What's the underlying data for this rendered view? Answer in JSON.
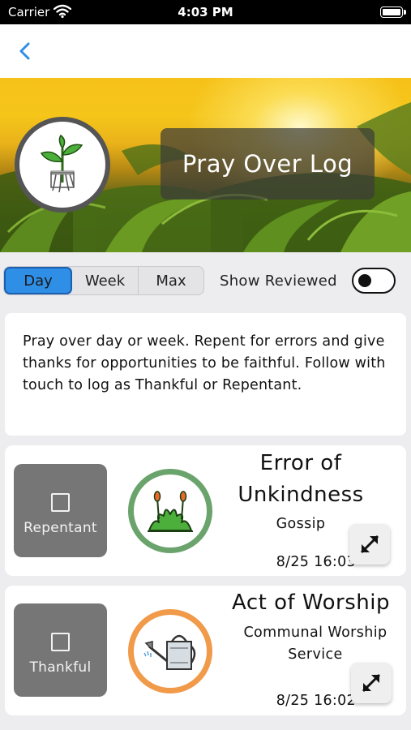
{
  "status_bar": {
    "carrier": "Carrier",
    "time": "4:03 PM"
  },
  "nav": {
    "back_icon": "chevron-left-icon",
    "accent": "#2f8fe6"
  },
  "hero": {
    "title": "Pray Over Log",
    "avatar_icon": "seedling-icon"
  },
  "filters": {
    "segments": [
      {
        "label": "Day",
        "selected": true
      },
      {
        "label": "Week",
        "selected": false
      },
      {
        "label": "Max",
        "selected": false
      }
    ],
    "show_reviewed_label": "Show Reviewed",
    "show_reviewed_on": false
  },
  "description": "Pray over day or week. Repent for errors and give thanks for opportunities to be faithful. Follow with touch to log as Thankful or Repentant.",
  "entries": [
    {
      "status_label": "Repentant",
      "checked": false,
      "icon": "weed-plant-icon",
      "ring_color": "#6aa36b",
      "title": "Error of Unkindness",
      "subtitle": "Gossip",
      "timestamp": "8/25 16:03"
    },
    {
      "status_label": "Thankful",
      "checked": false,
      "icon": "watering-can-icon",
      "ring_color": "#f09a4a",
      "title": "Act of Worship",
      "subtitle": "Communal Worship Service",
      "timestamp": "8/25 16:02"
    }
  ]
}
